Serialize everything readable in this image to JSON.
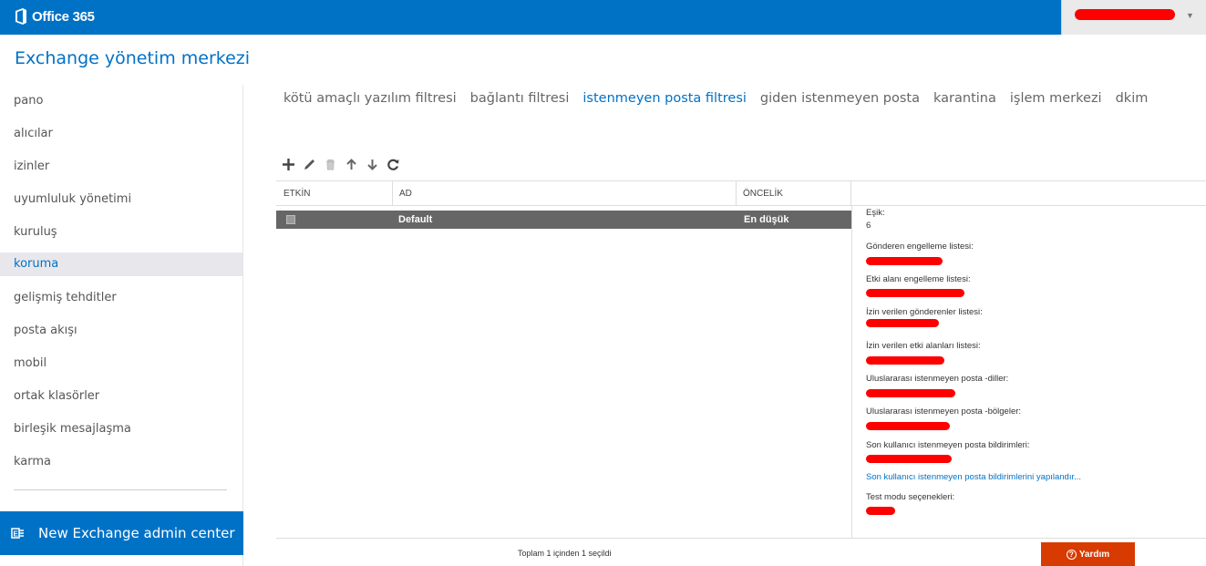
{
  "topbar": {
    "app_name": "Office 365",
    "user_name": ""
  },
  "page": {
    "title": "Exchange yönetim merkezi"
  },
  "nav": {
    "items": [
      {
        "label": "pano"
      },
      {
        "label": "alıcılar"
      },
      {
        "label": "izinler"
      },
      {
        "label": "uyumluluk yönetimi"
      },
      {
        "label": "kuruluş"
      },
      {
        "label": "koruma",
        "active": true
      },
      {
        "label": "gelişmiş tehditler"
      },
      {
        "label": "posta akışı"
      },
      {
        "label": "mobil"
      },
      {
        "label": "ortak klasörler"
      },
      {
        "label": "birleşik mesajlaşma"
      },
      {
        "label": "karma"
      }
    ],
    "new_eac": "New Exchange admin center"
  },
  "tabs": [
    {
      "label": "kötü amaçlı yazılım filtresi"
    },
    {
      "label": "bağlantı filtresi"
    },
    {
      "label": "istenmeyen posta filtresi",
      "active": true
    },
    {
      "label": "giden istenmeyen posta"
    },
    {
      "label": "karantina"
    },
    {
      "label": "işlem merkezi"
    },
    {
      "label": "dkim"
    }
  ],
  "toolbar": [
    "add-icon",
    "edit-icon",
    "delete-icon",
    "move-up-icon",
    "move-down-icon",
    "refresh-icon"
  ],
  "grid": {
    "columns": {
      "enabled": "ETKİN",
      "name": "AD",
      "priority": "ÖNCELİK"
    },
    "rows": [
      {
        "enabled": true,
        "name": "Default",
        "priority": "En düşük"
      }
    ],
    "status": "Toplam 1 içinden 1 seçildi"
  },
  "details": {
    "threshold_label": "Eşik:",
    "threshold_value": "6",
    "sender_block_label": "Gönderen engelleme listesi:",
    "domain_block_label": "Etki alanı engelleme listesi:",
    "allowed_senders_label": "İzin verilen gönderenler listesi:",
    "allowed_domains_label": "İzin verilen etki alanları listesi:",
    "intl_languages_label": "Uluslararası istenmeyen posta -diller:",
    "intl_regions_label": "Uluslararası istenmeyen posta -bölgeler:",
    "enduser_notif_label": "Son kullanıcı istenmeyen posta bildirimleri:",
    "enduser_configure_link": "Son kullanıcı istenmeyen posta bildirimlerini yapılandır...",
    "test_mode_label": "Test modu seçenekleri:"
  },
  "help": {
    "label": "Yardım"
  },
  "colors": {
    "brand": "#0072c6",
    "help": "#d83b01",
    "redaction": "#ff0000"
  }
}
